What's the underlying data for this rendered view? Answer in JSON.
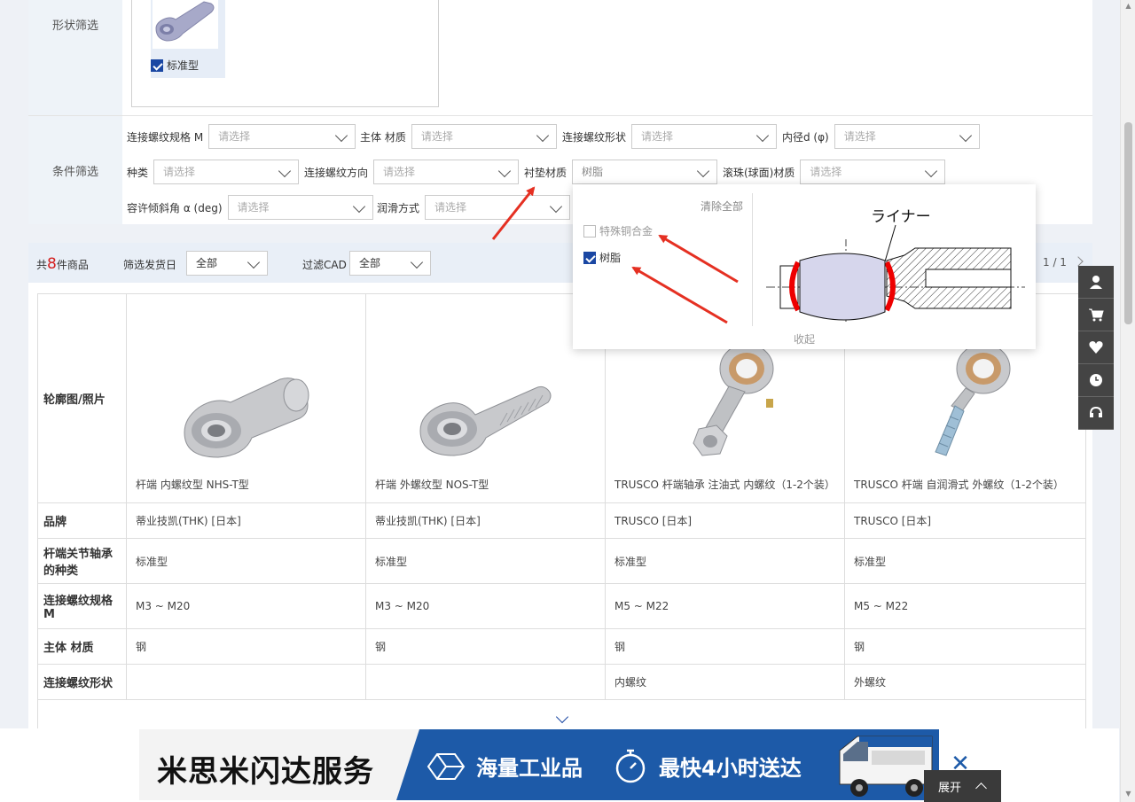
{
  "shape_filter": {
    "label": "形状筛选",
    "option": {
      "label": "标准型",
      "checked": true
    }
  },
  "condition_filter": {
    "label": "条件筛选",
    "fields": [
      {
        "label": "连接螺纹规格 M",
        "value": "请选择"
      },
      {
        "label": "主体 材质",
        "value": "请选择"
      },
      {
        "label": "连接螺纹形状",
        "value": "请选择"
      },
      {
        "label": "内径d (φ)",
        "value": "请选择"
      },
      {
        "label": "种类",
        "value": "请选择"
      },
      {
        "label": "连接螺纹方向",
        "value": "请选择"
      },
      {
        "label": "衬垫材质",
        "value": "树脂"
      },
      {
        "label": "滚珠(球面)材质",
        "value": "请选择"
      },
      {
        "label": "容许倾斜角 α (deg)",
        "value": "请选择"
      },
      {
        "label": "润滑方式",
        "value": "请选择"
      }
    ]
  },
  "popup": {
    "clear_all": "清除全部",
    "options": [
      {
        "label": "特殊铜合金",
        "checked": false
      },
      {
        "label": "树脂",
        "checked": true
      }
    ],
    "diagram_label": "ライナー",
    "collapse": "收起"
  },
  "results": {
    "count_prefix": "共",
    "count": "8",
    "count_suffix": "件商品",
    "ship_label": "筛选发货日",
    "ship_value": "全部",
    "cad_label": "过滤CAD",
    "cad_value": "全部",
    "pager": "1 / 1"
  },
  "table": {
    "row_headers": {
      "image": "轮廓图/照片",
      "brand": "品牌",
      "type": "杆端关节轴承的种类",
      "thread": "连接螺纹规格M",
      "material": "主体 材质",
      "thread_shape": "连接螺纹形状"
    },
    "products": [
      {
        "name": "杆端 内螺纹型 NHS-T型",
        "brand": "蒂业技凯(THK) [日本]",
        "type": "标准型",
        "thread": "M3 ~ M20",
        "material": "钢",
        "thread_shape": ""
      },
      {
        "name": "杆端 外螺纹型 NOS-T型",
        "brand": "蒂业技凯(THK) [日本]",
        "type": "标准型",
        "thread": "M3 ~ M20",
        "material": "钢",
        "thread_shape": ""
      },
      {
        "name": "TRUSCO 杆端轴承 注油式 内螺纹（1-2个装）",
        "brand": "TRUSCO [日本]",
        "type": "标准型",
        "thread": "M5 ~ M22",
        "material": "钢",
        "thread_shape": "内螺纹"
      },
      {
        "name": "TRUSCO 杆端 自润滑式 外螺纹（1-2个装）",
        "brand": "TRUSCO [日本]",
        "type": "标准型",
        "thread": "M5 ~ M22",
        "material": "钢",
        "thread_shape": "外螺纹"
      }
    ]
  },
  "banner": {
    "title": "米思米闪达服务",
    "item1": "海量工业品",
    "item2": "最快4小时送达",
    "expand": "展开"
  },
  "colors": {
    "accent": "#1a47a3",
    "count_red": "#d31f1f",
    "banner_blue": "#1d5aa8",
    "annotation_arrow": "#e53022"
  }
}
